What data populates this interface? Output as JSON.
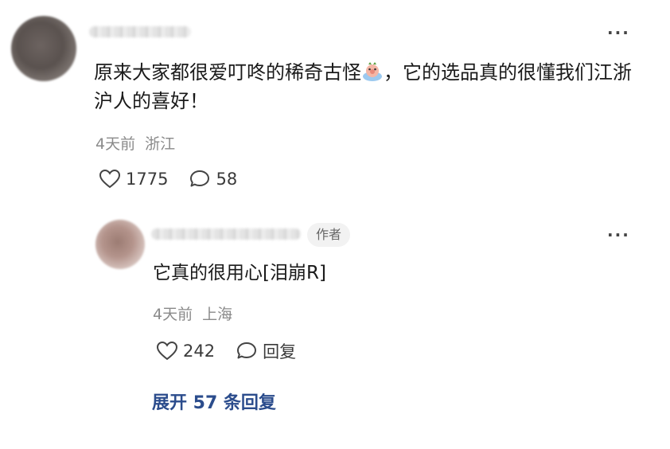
{
  "comment": {
    "text_part1": "原来大家都很爱叮咚的稀奇古怪",
    "emoji_icon": "crying-piglet-sticker",
    "text_part2": "，它的选品真的很懂我们江浙沪人的喜好！",
    "time": "4天前",
    "location": "浙江",
    "likes": "1775",
    "replies": "58"
  },
  "reply": {
    "author_tag": "作者",
    "text": "它真的很用心[泪崩R]",
    "time": "4天前",
    "location": "上海",
    "likes": "242",
    "reply_label": "回复"
  },
  "expand_label": "展开 57 条回复",
  "colors": {
    "link": "#2b4c8c",
    "meta": "#8a8a8a",
    "tag_bg": "#f2f2f2"
  }
}
